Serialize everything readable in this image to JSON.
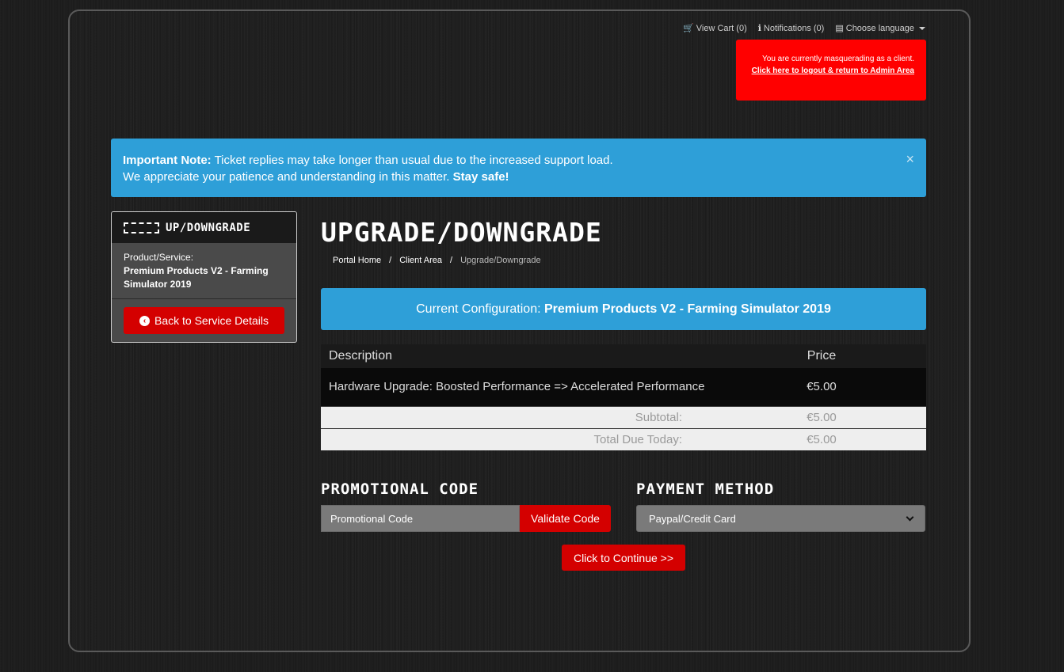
{
  "topnav": {
    "cart": "View Cart (0)",
    "notifications": "Notifications (0)",
    "language": "Choose language"
  },
  "masquerade": {
    "text": "You are currently masquerading as a client.",
    "link": "Click here to logout & return to Admin Area"
  },
  "notice": {
    "bold1": "Important Note:",
    "text1": " Ticket replies may take longer than usual due to the increased support load.",
    "text2": "We appreciate your patience and understanding in this matter. ",
    "bold2": "Stay safe!",
    "close": "×"
  },
  "sidebar": {
    "title": "UP/DOWNGRADE",
    "label": "Product/Service:",
    "product": "Premium Products V2 - Farming Simulator 2019",
    "back_button": "Back to Service Details"
  },
  "page": {
    "title": "UPGRADE/DOWNGRADE",
    "breadcrumb": [
      "Portal Home",
      "Client Area",
      "Upgrade/Downgrade"
    ],
    "config_label": "Current Configuration: ",
    "config_value": "Premium Products V2 - Farming Simulator 2019"
  },
  "table": {
    "headers": [
      "Description",
      "Price"
    ],
    "rows": [
      {
        "description": "Hardware Upgrade: Boosted Performance => Accelerated Performance",
        "price": "€5.00"
      }
    ],
    "subtotal_label": "Subtotal:",
    "subtotal": "€5.00",
    "total_label": "Total Due Today:",
    "total": "€5.00"
  },
  "promo": {
    "title": "PROMOTIONAL CODE",
    "placeholder": "Promotional Code",
    "button": "Validate Code"
  },
  "payment": {
    "title": "PAYMENT METHOD",
    "selected": "Paypal/Credit Card"
  },
  "continue_button": "Click to Continue >>",
  "colors": {
    "accent_blue": "#2e9fd8",
    "accent_red": "#d40000",
    "alert_red": "#ff0000"
  }
}
